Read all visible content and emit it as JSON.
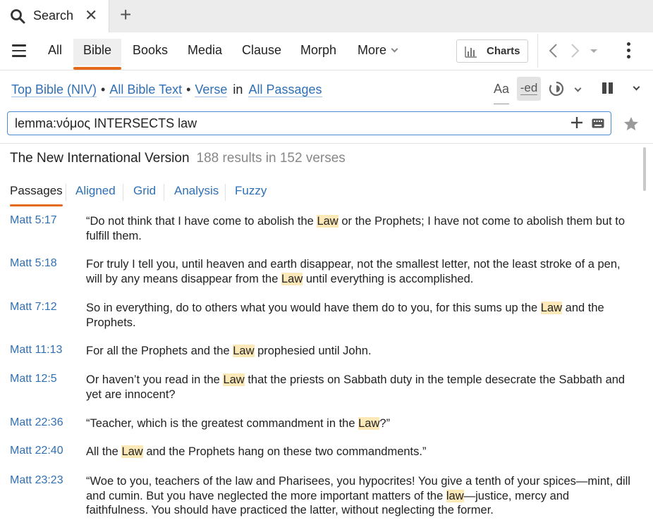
{
  "tab": {
    "label": "Search",
    "close": "✕",
    "new_tab": "+"
  },
  "toolbar": {
    "nav_tabs": [
      "All",
      "Bible",
      "Books",
      "Media",
      "Clause",
      "Morph",
      "More"
    ],
    "active_tab": "Bible",
    "charts_label": "Charts"
  },
  "scope": {
    "bible": "Top Bible (NIV)",
    "text": "All Bible Text",
    "unit": "Verse",
    "in": "in",
    "range": "All Passages",
    "sep": "•",
    "aa": "Aa",
    "ed": "-ed"
  },
  "search": {
    "query": "lemma:νόμος INTERSECTS law"
  },
  "results_header": {
    "version": "The New International Version",
    "count": "188 results in 152 verses"
  },
  "subtabs": [
    "Passages",
    "Aligned",
    "Grid",
    "Analysis",
    "Fuzzy"
  ],
  "results": [
    {
      "ref": "Matt 5:17",
      "parts": [
        "“Do not think that I have come to abolish the ",
        "Law",
        " or the Prophets; I have not come to abolish them but to fulfill them."
      ]
    },
    {
      "ref": "Matt 5:18",
      "parts": [
        "For truly I tell you, until heaven and earth disappear, not the smallest letter, not the least stroke of a pen, will by any means disappear from the ",
        "Law",
        " until everything is accomplished."
      ]
    },
    {
      "ref": "Matt 7:12",
      "parts": [
        "So in everything, do to others what you would have them do to you, for this sums up the ",
        "Law",
        " and the Prophets."
      ]
    },
    {
      "ref": "Matt 11:13",
      "parts": [
        "For all the Prophets and the ",
        "Law",
        " prophesied until John."
      ]
    },
    {
      "ref": "Matt 12:5",
      "parts": [
        "Or haven’t you read in the ",
        "Law",
        " that the priests on Sabbath duty in the temple desecrate the Sabbath and yet are innocent?"
      ]
    },
    {
      "ref": "Matt 22:36",
      "parts": [
        "“Teacher, which is the greatest commandment in the ",
        "Law",
        "?”"
      ]
    },
    {
      "ref": "Matt 22:40",
      "parts": [
        "All the ",
        "Law",
        " and the Prophets hang on these two commandments.”"
      ]
    },
    {
      "ref": "Matt 23:23",
      "parts": [
        "“Woe to you, teachers of the law and Pharisees, you hypocrites! You give a tenth of your spices—mint, dill and cumin. But you have neglected the more important matters of the ",
        "law",
        "—justice, mercy and faithfulness. You should have practiced the latter, without neglecting the former."
      ]
    }
  ],
  "colors": {
    "accent": "#e36a1a",
    "link": "#2f70b5",
    "highlight": "#fde9b8",
    "focus_border": "#4a8ad0"
  }
}
